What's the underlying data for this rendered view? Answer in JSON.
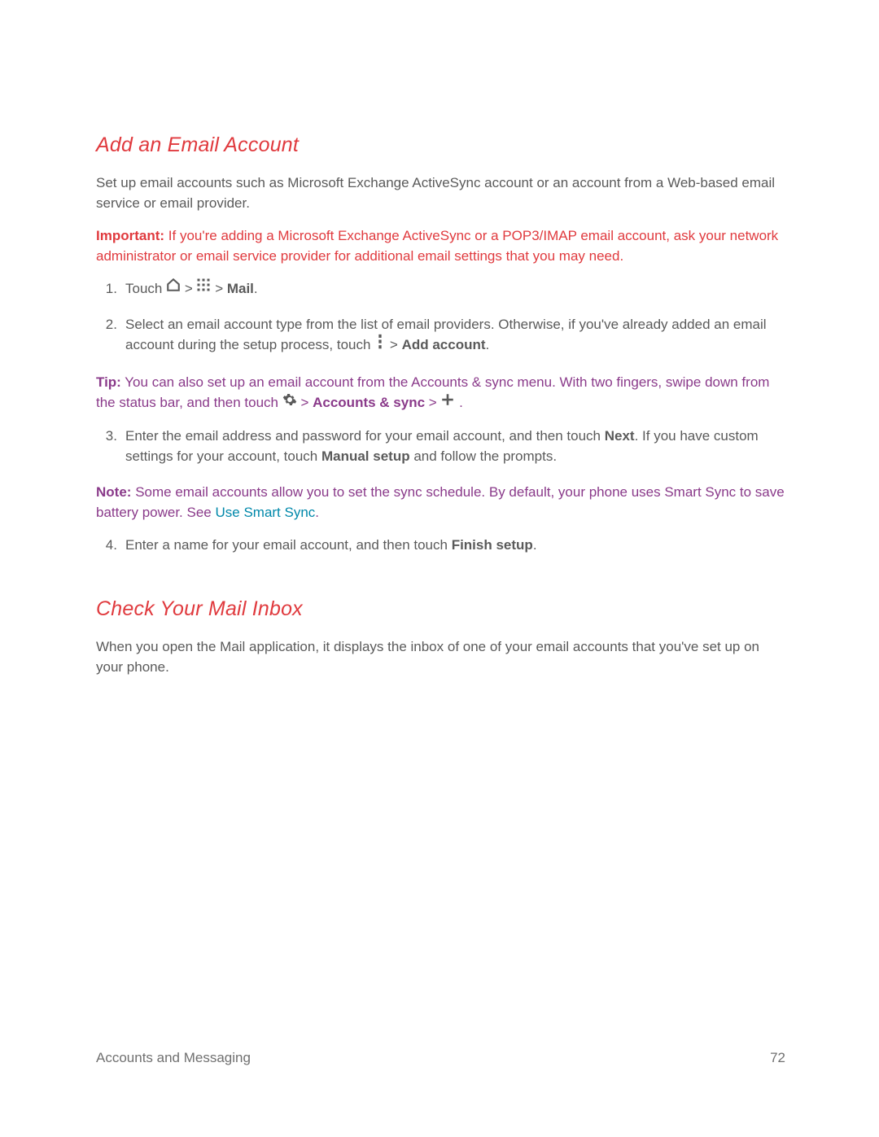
{
  "sections": {
    "addEmail": {
      "heading": "Add an Email Account",
      "intro": "Set up email accounts such as Microsoft Exchange ActiveSync account or an account from a Web-based email service or email provider.",
      "importantLabel": "Important:",
      "importantText": "If you're adding a Microsoft Exchange ActiveSync or a POP3/IMAP email account, ask your network administrator or email service provider for additional email settings that you may need.",
      "step1_touch": "Touch ",
      "step1_gt1": " > ",
      "step1_gt2": " > ",
      "step1_mail": "Mail",
      "step1_end": ".",
      "step2_a": "Select an email account type from the list of email providers. Otherwise, if you've already added an email account during the setup process, touch ",
      "step2_gt": " > ",
      "step2_add": "Add account",
      "step2_end": ".",
      "tipLabel": "Tip:",
      "tip_a": "You can also set up an email account from the Accounts & sync menu. With two fingers, swipe down from the status bar, and then touch ",
      "tip_gt1": " > ",
      "tip_accsync": "Accounts & sync",
      "tip_gt2": " > ",
      "tip_end": " .",
      "step3_a": "Enter the email address and password for your email account, and then touch ",
      "step3_next": "Next",
      "step3_b": ". If you have custom settings for your account, touch ",
      "step3_manual": "Manual setup",
      "step3_c": " and follow the prompts.",
      "noteLabel": "Note:",
      "note_a": "Some email accounts allow you to set the sync schedule. By default, your phone uses Smart Sync to save battery power. See ",
      "note_link": "Use Smart Sync",
      "note_end": ".",
      "step4_a": "Enter a name for your email account, and then touch ",
      "step4_finish": "Finish setup",
      "step4_end": "."
    },
    "checkMail": {
      "heading": "Check Your Mail Inbox",
      "intro": "When you open the Mail application, it displays the inbox of one of your email accounts that you've set up on your phone."
    }
  },
  "footer": {
    "section": "Accounts and Messaging",
    "page": "72"
  }
}
